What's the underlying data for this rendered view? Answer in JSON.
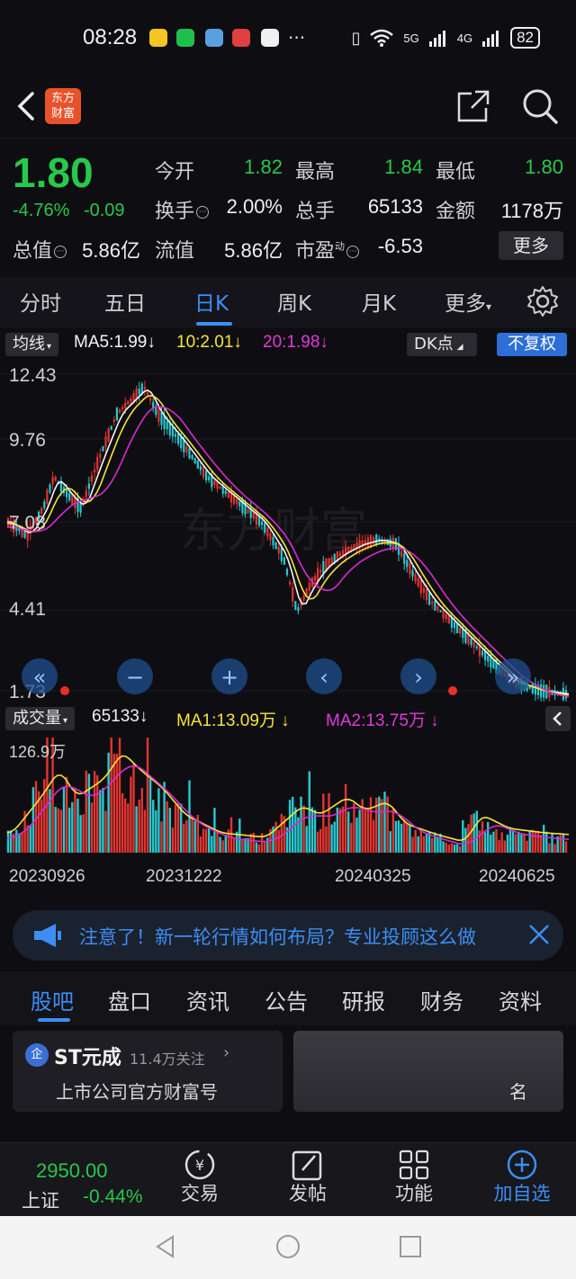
{
  "status_bar": {
    "time": "08:28",
    "battery": "82",
    "network_1": "5G",
    "network_2": "4G"
  },
  "header": {
    "logo_text": "东方\n财富"
  },
  "quote": {
    "price": "1.80",
    "change_pct": "-4.76%",
    "change_abs": "-0.09",
    "rows": [
      [
        {
          "label": "今开",
          "value": "1.82",
          "color": "green"
        },
        {
          "label": "最高",
          "value": "1.84",
          "color": "green"
        },
        {
          "label": "最低",
          "value": "1.80",
          "color": "green"
        }
      ],
      [
        {
          "label": "换手",
          "value": "2.00%",
          "color": "white"
        },
        {
          "label": "总手",
          "value": "65133",
          "color": "white"
        },
        {
          "label": "金额",
          "value": "1178万",
          "color": "white"
        }
      ],
      [
        {
          "label": "总值",
          "value": "5.86亿",
          "color": "white"
        },
        {
          "label": "流值",
          "value": "5.86亿",
          "color": "white"
        },
        {
          "label": "市盈",
          "value": "-6.53",
          "color": "white"
        }
      ]
    ],
    "pe_superscript": "动",
    "more_label": "更多"
  },
  "period_tabs": [
    "分时",
    "五日",
    "日K",
    "周K",
    "月K",
    "更多"
  ],
  "active_period": "日K",
  "indicator_bar": {
    "ma_selector": "均线",
    "ma5": "MA5:1.99",
    "ma10": "10:2.01",
    "ma20": "20:1.98",
    "dk_label": "DK点",
    "adjust_label": "不复权"
  },
  "colors": {
    "up": "#e2342f",
    "down": "#28c8d0",
    "price_green": "#28c84b",
    "accent": "#3b8ff5",
    "ma5": "#f5f5f5",
    "ma10": "#f5e43a",
    "ma20": "#d92ad0"
  },
  "kline": {
    "y_labels": [
      "12.43",
      "9.76",
      "7.08",
      "4.41",
      "1.73"
    ],
    "watermark": "东方财富",
    "controls": [
      "double-left-icon",
      "zoom-out-icon",
      "zoom-in-icon",
      "prev-icon",
      "next-icon",
      "double-right-icon"
    ]
  },
  "volume_bar": {
    "selector": "成交量",
    "vol": "65133",
    "ma1": "MA1:13.09万",
    "ma2": "MA2:13.75万"
  },
  "volume_chart": {
    "y_label": "126.9万",
    "x_labels": [
      "20230926",
      "20231222",
      "20240325",
      "20240625"
    ]
  },
  "ticker": {
    "text": "注意了！新一轮行情如何布局？专业投顾这么做"
  },
  "section_tabs": [
    "股吧",
    "盘口",
    "资讯",
    "公告",
    "研报",
    "财务",
    "资料"
  ],
  "active_section": "股吧",
  "company_card": {
    "name": "ST元成",
    "followers": "11.4万关注",
    "subtitle": "上市公司官方财富号",
    "badge": "企"
  },
  "promo_card": {
    "visible_text": "名"
  },
  "bottom_nav": {
    "index_value": "2950.00",
    "index_name": "上证",
    "index_change": "-0.44%",
    "items": [
      {
        "label": "交易",
        "icon": "yuan-circle-icon"
      },
      {
        "label": "发帖",
        "icon": "edit-icon"
      },
      {
        "label": "功能",
        "icon": "grid-icon"
      },
      {
        "label": "加自选",
        "icon": "add-circle-icon"
      }
    ]
  }
}
